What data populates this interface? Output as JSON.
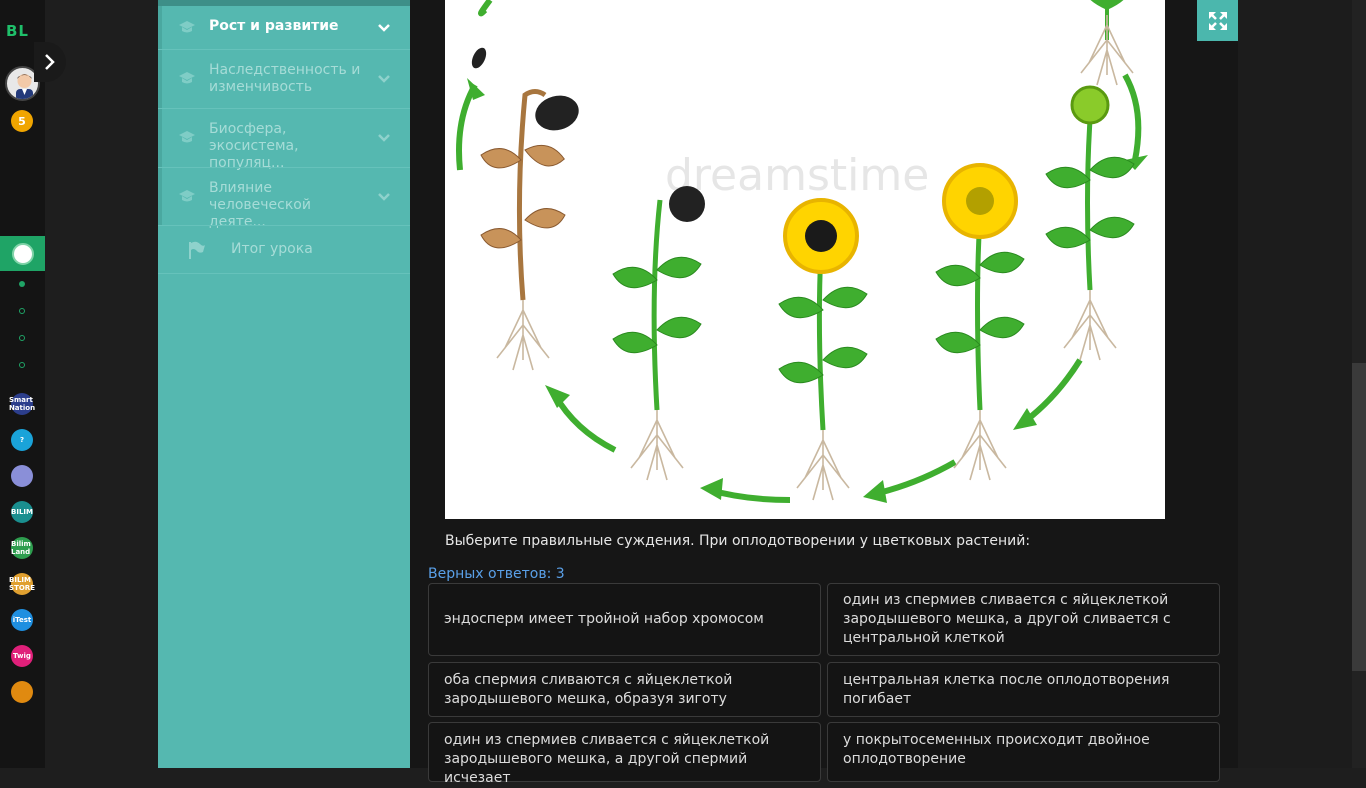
{
  "rail": {
    "logo": "BL",
    "coin_count": "5",
    "apps": [
      {
        "name": "smart-nation-app-icon",
        "text": "Smart Nation",
        "color": "#2c3e8c"
      },
      {
        "name": "help-app-icon",
        "text": "?",
        "color": "#1aa3d9"
      },
      {
        "name": "news-app-icon",
        "text": "",
        "color": "#8a8fd8"
      },
      {
        "name": "bilim-app-icon",
        "text": "BILIM",
        "color": "#1a8f8f"
      },
      {
        "name": "bilim-land-app-icon",
        "text": "Bilim Land",
        "color": "#2e9e4f"
      },
      {
        "name": "bilim-store-app-icon",
        "text": "BILIM STORE",
        "color": "#e0a030"
      },
      {
        "name": "test-app-icon",
        "text": "iTest",
        "color": "#1f8fe0"
      },
      {
        "name": "twig-app-icon",
        "text": "Twig",
        "color": "#e0207a"
      },
      {
        "name": "bilimtap-app-icon",
        "text": "",
        "color": "#e08a10"
      }
    ],
    "colors": {
      "active": "#1fa466",
      "dot": "#1fa466"
    }
  },
  "sidebar": {
    "items": [
      {
        "label": "Рост и развитие",
        "active": true
      },
      {
        "label": "Наследственность и изменчивость",
        "active": false
      },
      {
        "label": "Биосфера, экосистема, популяц...",
        "active": false
      },
      {
        "label": "Влияние человеческой деяте...",
        "active": false
      }
    ],
    "summary_label": "Итог урока"
  },
  "main": {
    "question": "Выберите правильные суждения. При оплодотворении у цветковых растений:",
    "correct_count": "Верных ответов: 3",
    "options": [
      "эндосперм имеет тройной набор хромосом",
      "один из спермиев сливается с яйцеклеткой зародышевого мешка, а другой сливается с центральной клеткой",
      "оба спермия сливаются с яйцеклеткой зародышевого мешка, образуя зиготу",
      "центральная клетка после оплодотворения погибает",
      "один из спермиев сливается с яйцеклеткой зародышевого мешка, а другой спермий исчезает",
      "у покрытосеменных происходит двойное оплодотворение"
    ],
    "watermark": "dreamstime"
  }
}
